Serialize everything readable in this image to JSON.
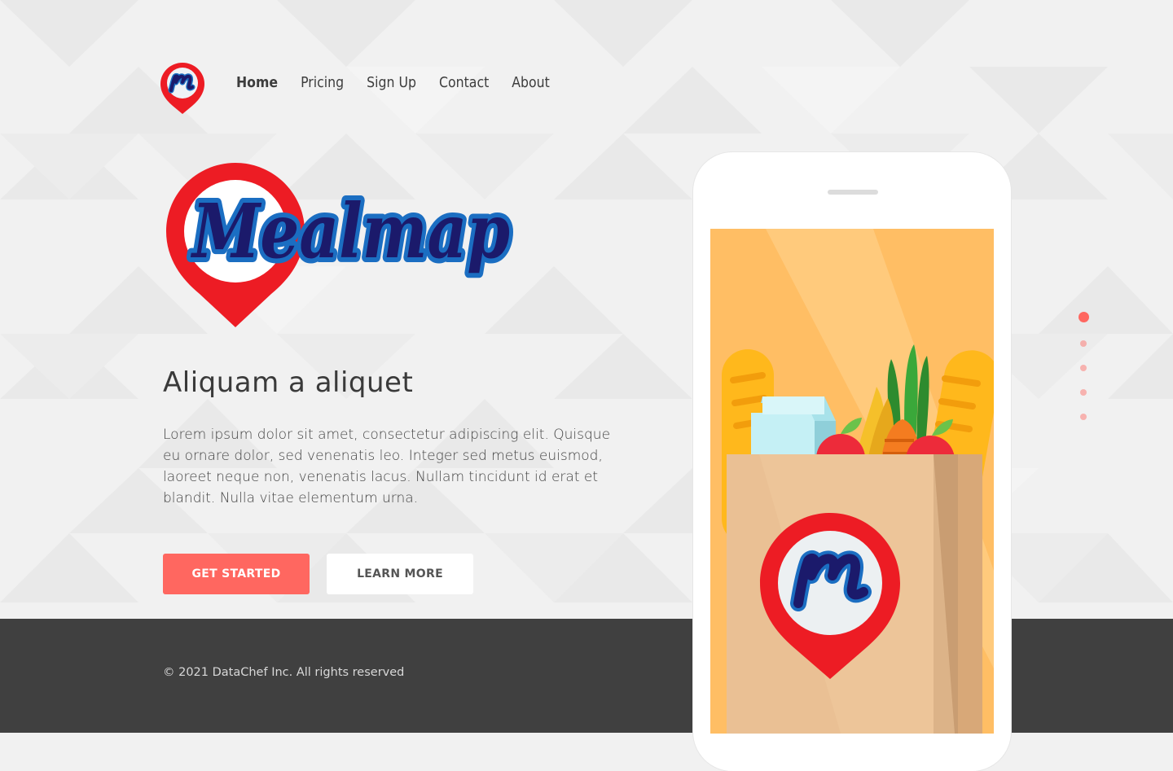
{
  "app": {
    "brand_name": "Mealmap"
  },
  "nav": {
    "items": [
      {
        "label": "Home",
        "active": true
      },
      {
        "label": "Pricing",
        "active": false
      },
      {
        "label": "Sign Up",
        "active": false
      },
      {
        "label": "Contact",
        "active": false
      },
      {
        "label": "About",
        "active": false
      }
    ]
  },
  "hero": {
    "headline": "Aliquam a aliquet",
    "body": "Lorem ipsum dolor sit amet, consectetur adipiscing elit. Quisque eu ornare dolor, sed venenatis leo. Integer sed metus euismod, laoreet neque non, venenatis lacus. Nullam tincidunt id erat et blandit. Nulla vitae elementum urna.",
    "primary_button": "GET STARTED",
    "secondary_button": "LEARN MORE"
  },
  "slider": {
    "count": 5,
    "active_index": 0
  },
  "footer": {
    "copyright": "© 2021 DataChef Inc. All rights reserved"
  },
  "colors": {
    "accent": "#ff6760",
    "brand_red": "#ed1c24",
    "brand_navy": "#1b1a6b",
    "brand_blue": "#1b6ec2",
    "footer_bg": "#404040",
    "screen_bg": "#ffbe64"
  },
  "icons": {
    "nav_logo": "mealmap-pin-logo-icon",
    "hero_logo": "mealmap-wordmark-logo",
    "phone_art": "grocery-bag-illustration"
  }
}
